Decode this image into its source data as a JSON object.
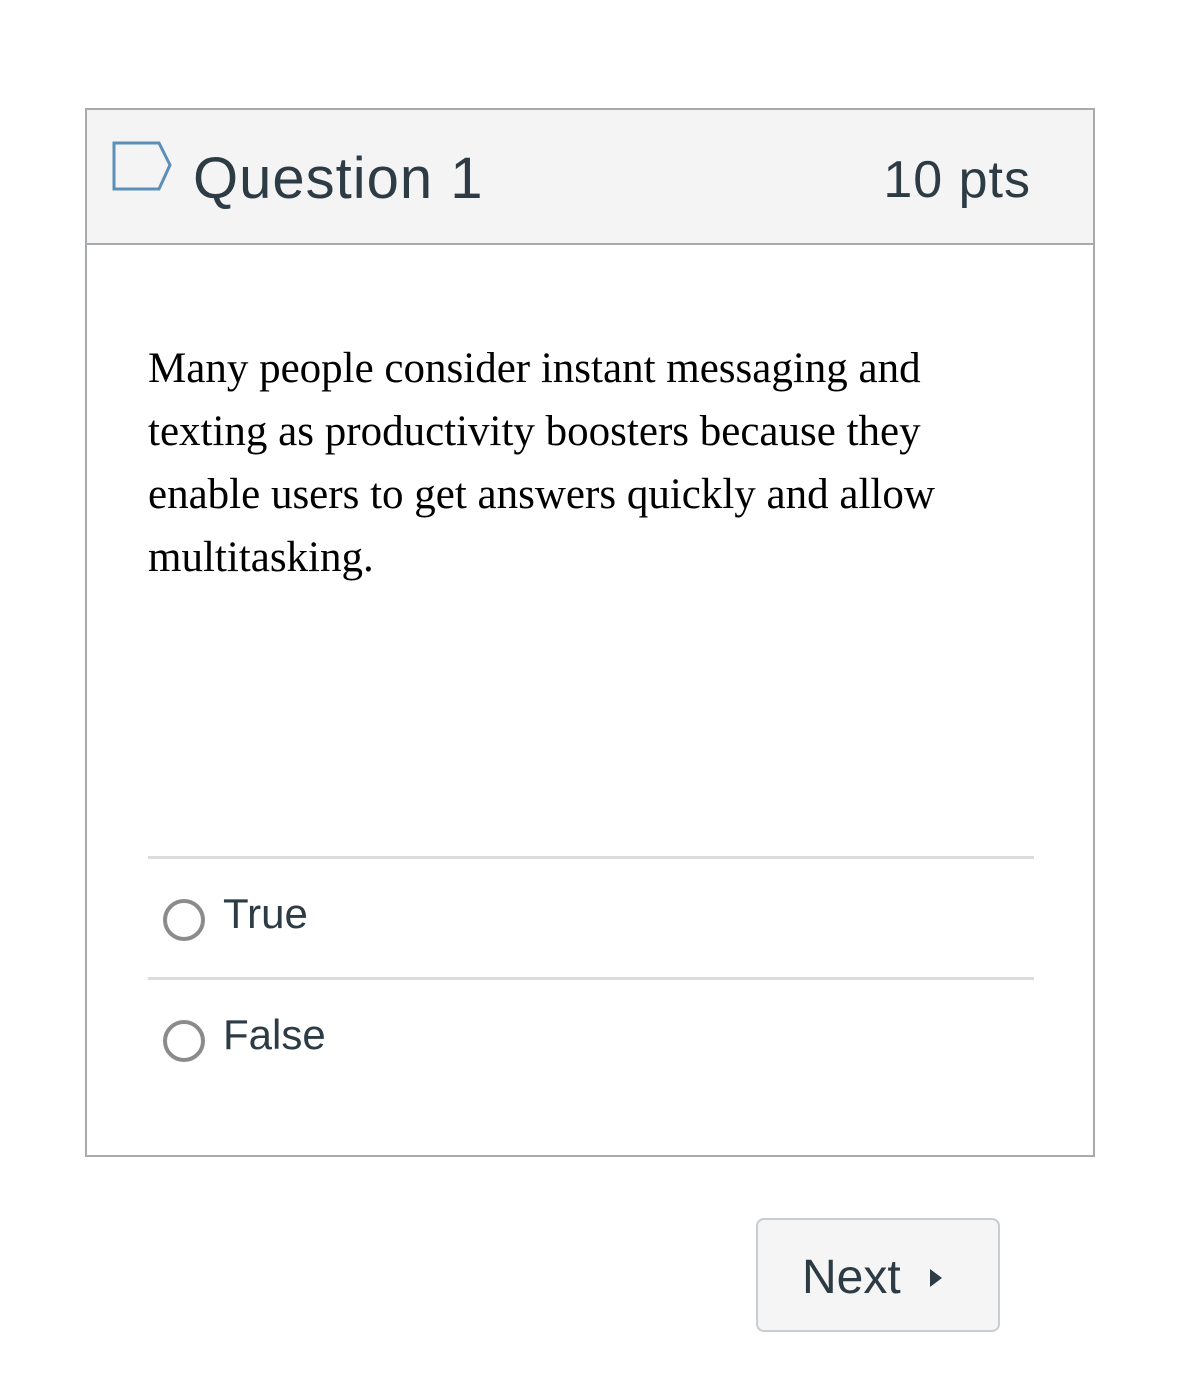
{
  "question": {
    "flag_icon": "flag-bookmark-icon",
    "title": "Question 1",
    "points": "10 pts",
    "text": "Many people consider instant messaging and texting as productivity boosters because they enable users to get answers quickly and allow multitasking.",
    "answers": [
      {
        "label": "True",
        "selected": false
      },
      {
        "label": "False",
        "selected": false
      }
    ]
  },
  "navigation": {
    "next_label": "Next",
    "next_icon": "caret-right-icon"
  },
  "colors": {
    "header_bg": "#f4f4f4",
    "border": "#a8abad",
    "text_dark": "#2d3b45",
    "flag": "#5b8fb9",
    "radio_border": "#8b8b8b"
  }
}
